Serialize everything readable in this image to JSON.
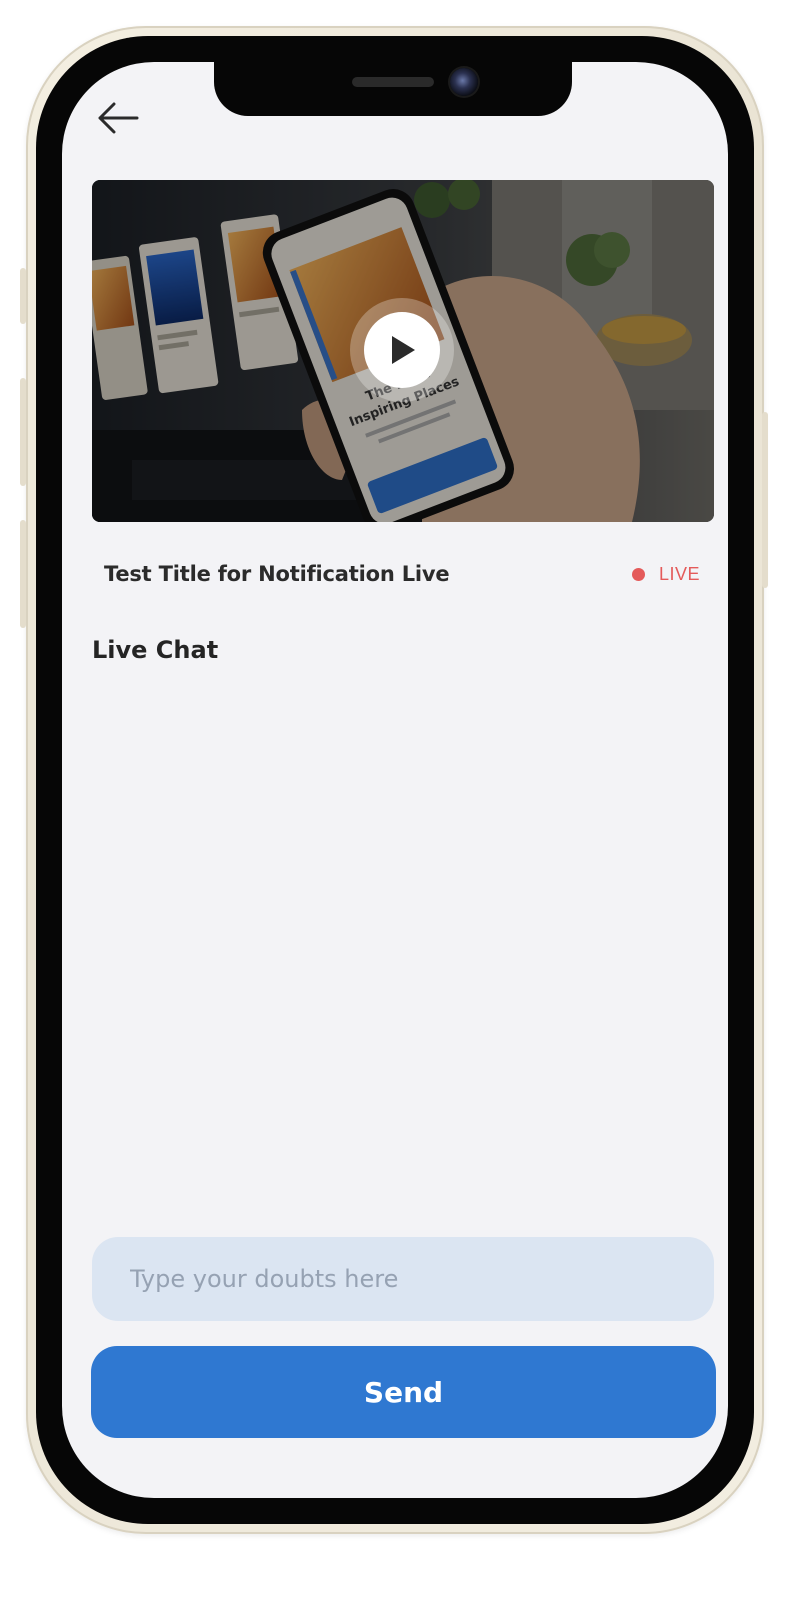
{
  "header": {
    "back_icon": "arrow-left-icon"
  },
  "video": {
    "play_icon": "play-icon",
    "preview": {
      "heading_line1": "The Most",
      "heading_line2": "Inspiring Places"
    }
  },
  "stream": {
    "title": "Test Title for Notification Live",
    "status_label": "LIVE",
    "status_color": "#e45a5a"
  },
  "chat": {
    "heading": "Live Chat",
    "messages": [],
    "input_placeholder": "Type your doubts here",
    "input_value": "",
    "send_label": "Send"
  },
  "theme": {
    "accent": "#2f78d1",
    "input_bg": "#dbe5f2",
    "screen_bg": "#f3f3f6"
  }
}
